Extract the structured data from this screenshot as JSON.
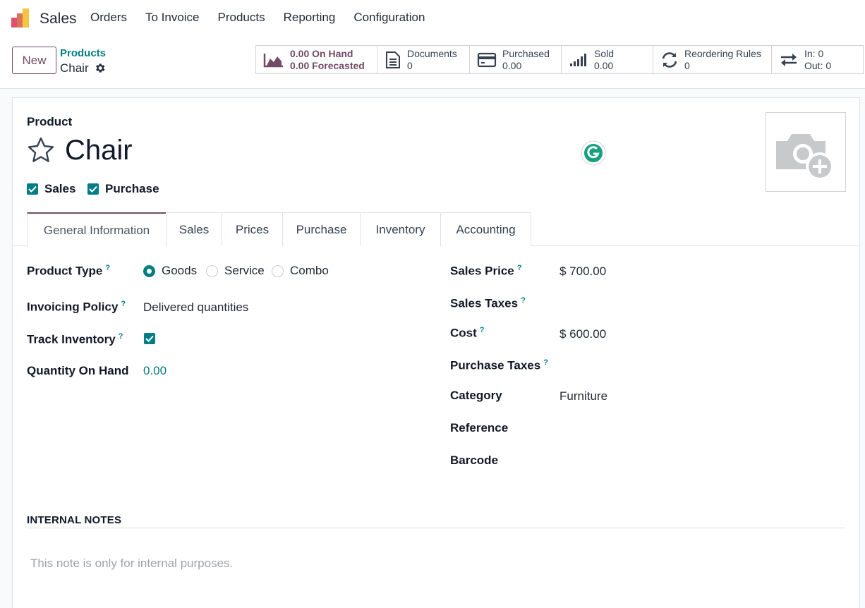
{
  "navbar": {
    "app_name": "Sales",
    "menu": [
      "Orders",
      "To Invoice",
      "Products",
      "Reporting",
      "Configuration"
    ]
  },
  "control": {
    "new_label": "New",
    "breadcrumb_parent": "Products",
    "breadcrumb_current": "Chair"
  },
  "stats": {
    "on_hand": "0.00 On Hand",
    "forecasted": "0.00 Forecasted",
    "documents_label": "Documents",
    "documents_value": "0",
    "purchased_label": "Purchased",
    "purchased_value": "0.00",
    "sold_label": "Sold",
    "sold_value": "0.00",
    "reorder_label": "Reordering Rules",
    "reorder_value": "0",
    "in_label": "In: 0",
    "out_label": "Out: 0"
  },
  "form": {
    "product_label": "Product",
    "product_name": "Chair",
    "can_be_sold": "Sales",
    "can_be_purchased": "Purchase",
    "tabs": [
      "General Information",
      "Sales",
      "Prices",
      "Purchase",
      "Inventory",
      "Accounting"
    ],
    "left": {
      "product_type_label": "Product Type",
      "type_options": [
        "Goods",
        "Service",
        "Combo"
      ],
      "invoicing_label": "Invoicing Policy",
      "invoicing_value": "Delivered quantities",
      "track_label": "Track Inventory",
      "qty_label": "Quantity On Hand",
      "qty_value": "0.00"
    },
    "right": {
      "sales_price_label": "Sales Price",
      "sales_price_value": "$ 700.00",
      "sales_taxes_label": "Sales Taxes",
      "cost_label": "Cost",
      "cost_value": "$ 600.00",
      "purchase_taxes_label": "Purchase Taxes",
      "category_label": "Category",
      "category_value": "Furniture",
      "reference_label": "Reference",
      "barcode_label": "Barcode"
    },
    "notes_title": "INTERNAL NOTES",
    "notes_placeholder": "This note is only for internal purposes.",
    "help_mark": "?"
  },
  "colors": {
    "brand": "#714b67",
    "accent": "#017e84"
  }
}
